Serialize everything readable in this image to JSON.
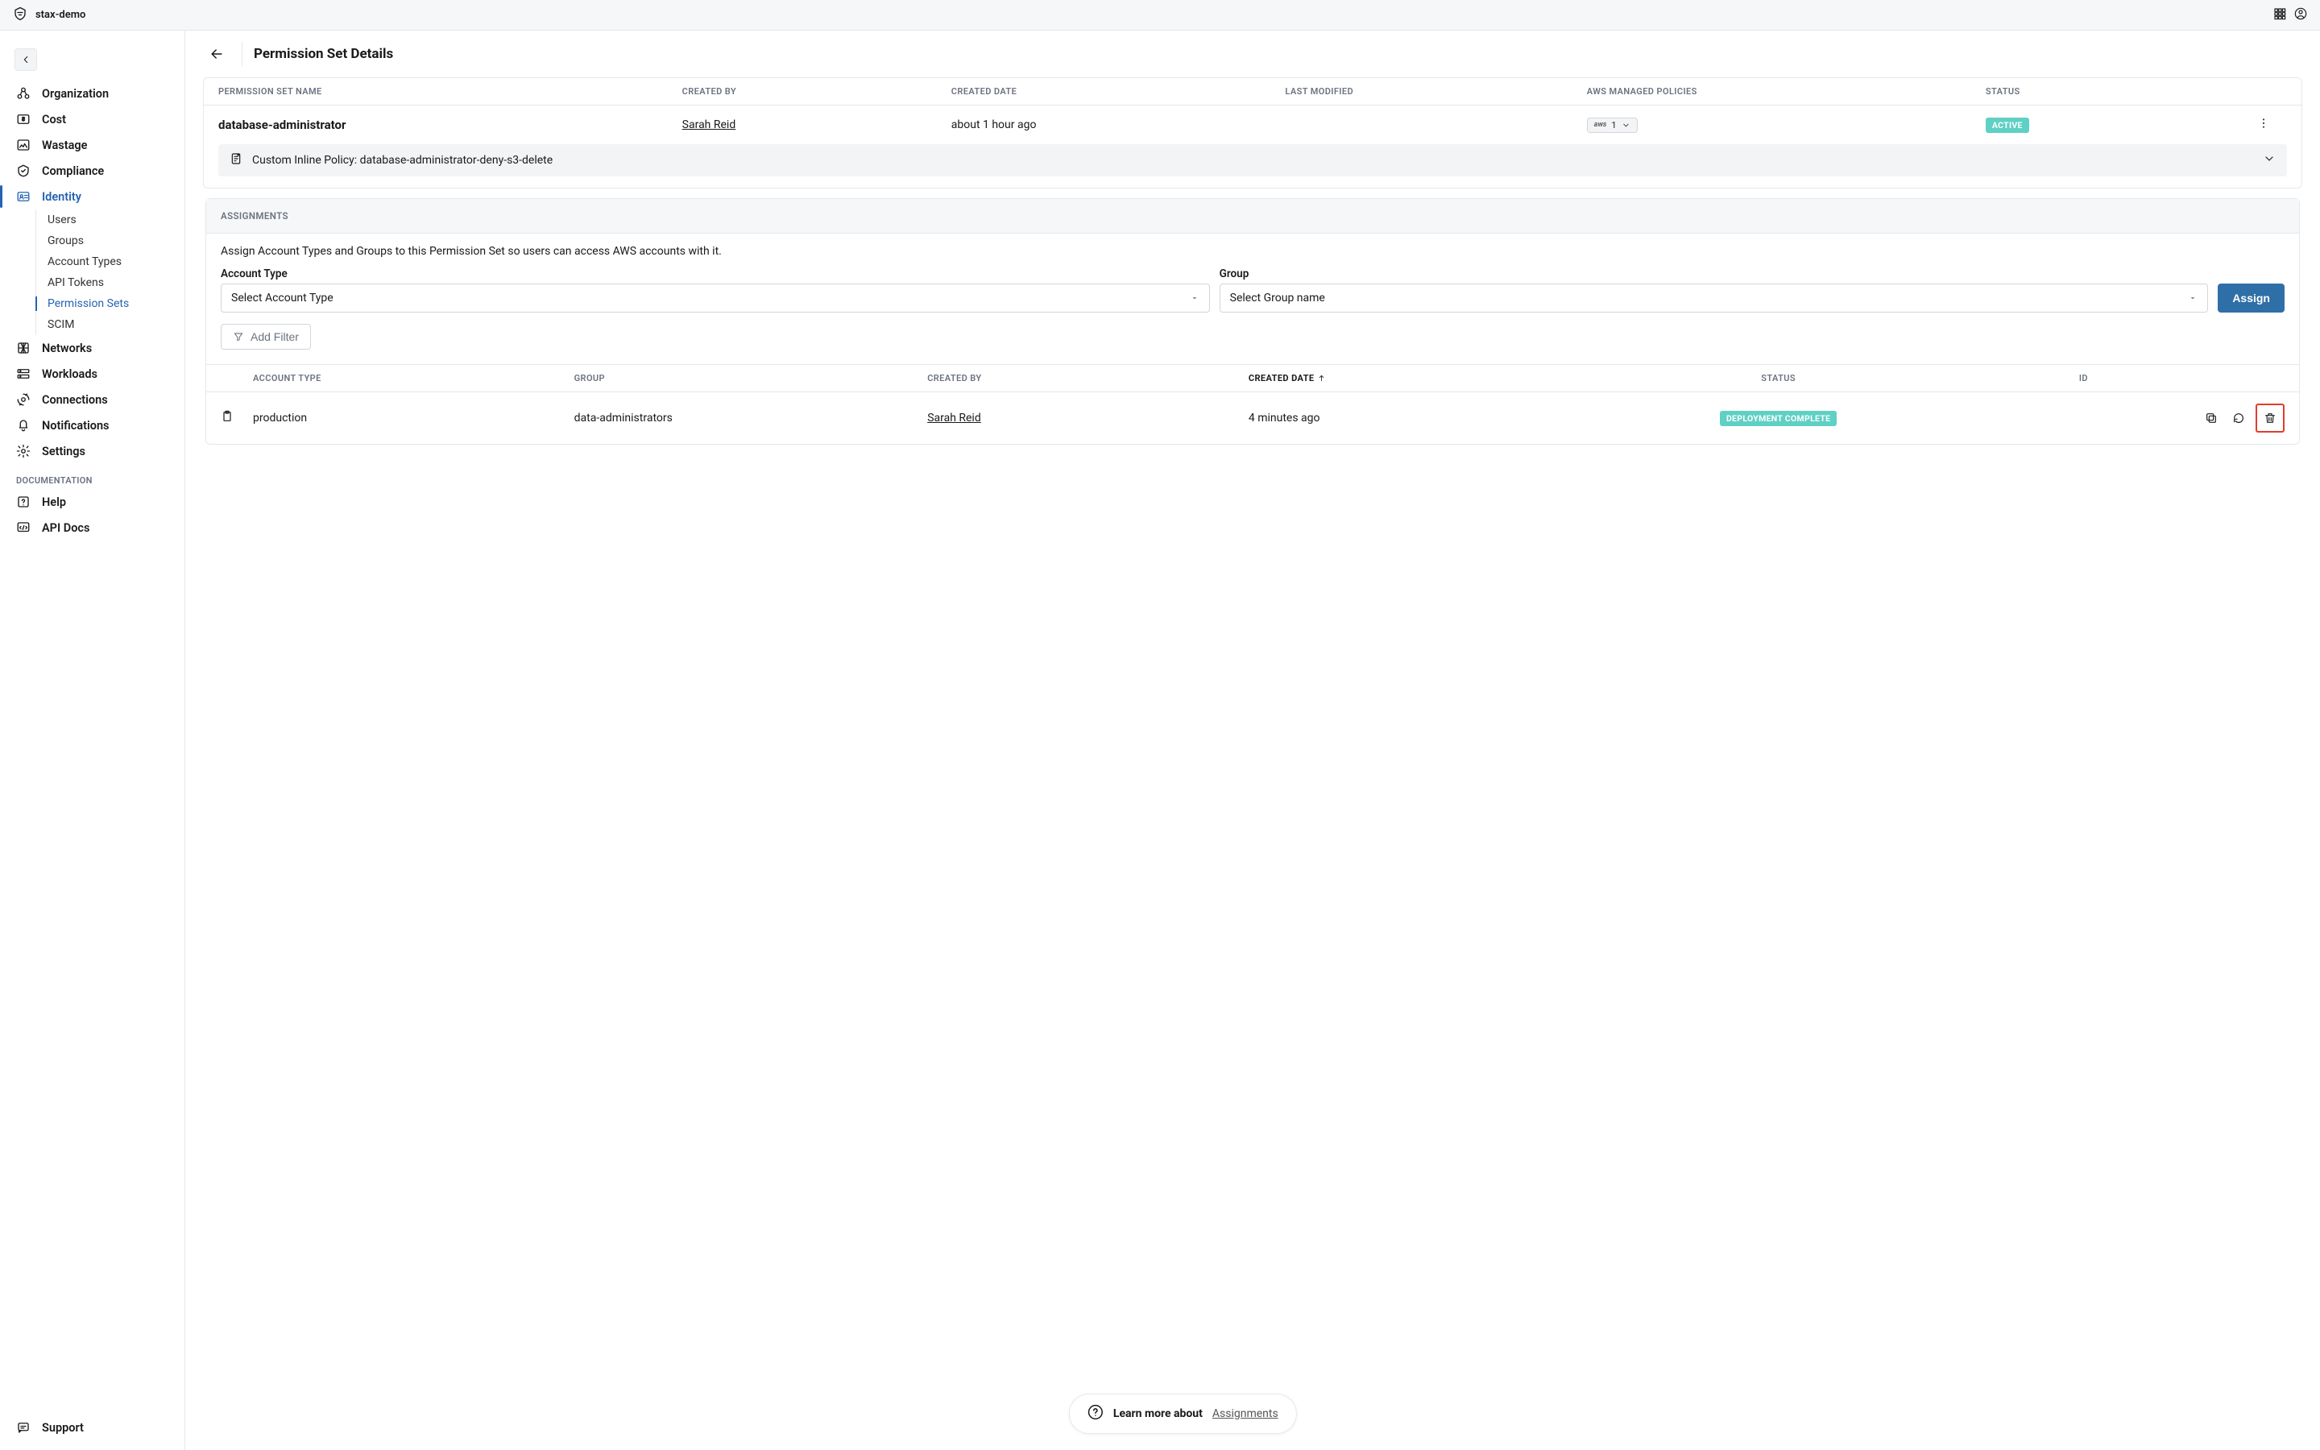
{
  "topbar": {
    "workspace": "stax-demo"
  },
  "sidebar": {
    "items": [
      {
        "key": "organization",
        "label": "Organization"
      },
      {
        "key": "cost",
        "label": "Cost"
      },
      {
        "key": "wastage",
        "label": "Wastage"
      },
      {
        "key": "compliance",
        "label": "Compliance"
      },
      {
        "key": "identity",
        "label": "Identity",
        "active": true,
        "sub": [
          {
            "key": "users",
            "label": "Users"
          },
          {
            "key": "groups",
            "label": "Groups"
          },
          {
            "key": "account-types",
            "label": "Account Types"
          },
          {
            "key": "api-tokens",
            "label": "API Tokens"
          },
          {
            "key": "permission-sets",
            "label": "Permission Sets",
            "active": true
          },
          {
            "key": "scim",
            "label": "SCIM"
          }
        ]
      },
      {
        "key": "networks",
        "label": "Networks"
      },
      {
        "key": "workloads",
        "label": "Workloads"
      },
      {
        "key": "connections",
        "label": "Connections"
      },
      {
        "key": "notifications",
        "label": "Notifications"
      },
      {
        "key": "settings",
        "label": "Settings"
      }
    ],
    "docLabel": "DOCUMENTATION",
    "docs": [
      {
        "key": "help",
        "label": "Help"
      },
      {
        "key": "api-docs",
        "label": "API Docs"
      }
    ],
    "support": "Support"
  },
  "page": {
    "title": "Permission Set Details",
    "cols": {
      "name": "PERMISSION SET NAME",
      "createdBy": "CREATED BY",
      "createdDate": "CREATED DATE",
      "lastModified": "LAST MODIFIED",
      "awsPolicies": "AWS MANAGED POLICIES",
      "status": "STATUS"
    },
    "row": {
      "name": "database-administrator",
      "createdBy": "Sarah Reid",
      "createdDate": "about 1 hour ago",
      "lastModified": "",
      "awsCount": "1",
      "awsLabel": "aws",
      "status": "ACTIVE"
    },
    "inlinePolicy": {
      "prefix": "Custom Inline Policy: ",
      "name": "database-administrator-deny-s3-delete"
    }
  },
  "assignments": {
    "header": "ASSIGNMENTS",
    "desc": "Assign Account Types and Groups to this Permission Set so users can access AWS accounts with it.",
    "accountTypeLabel": "Account Type",
    "accountTypePlaceholder": "Select Account Type",
    "groupLabel": "Group",
    "groupPlaceholder": "Select Group name",
    "assignBtn": "Assign",
    "addFilter": "Add Filter",
    "cols": {
      "accountType": "ACCOUNT TYPE",
      "group": "GROUP",
      "createdBy": "CREATED BY",
      "createdDate": "CREATED DATE",
      "status": "STATUS",
      "id": "ID"
    },
    "rows": [
      {
        "accountType": "production",
        "group": "data-administrators",
        "createdBy": "Sarah Reid",
        "createdDate": "4 minutes ago",
        "status": "DEPLOYMENT COMPLETE"
      }
    ]
  },
  "learnMore": {
    "text": "Learn more about",
    "link": "Assignments"
  }
}
